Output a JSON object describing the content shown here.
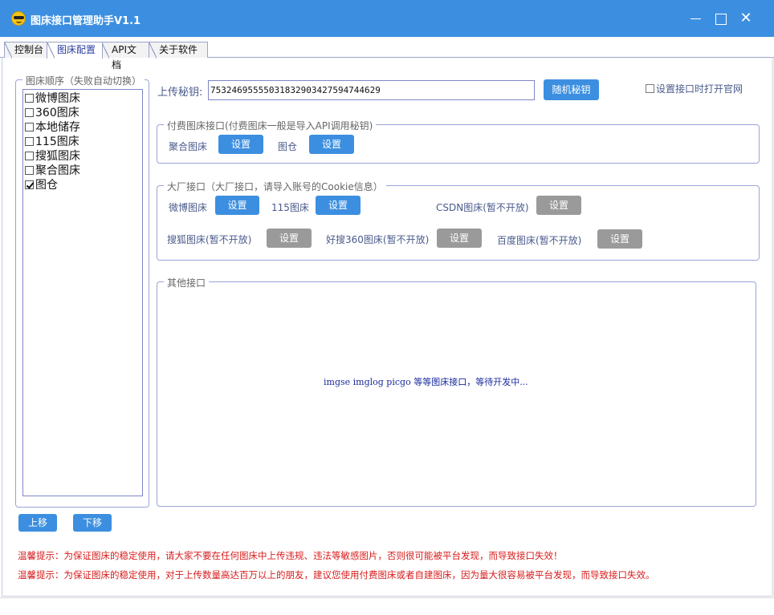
{
  "window": {
    "title": "图床接口管理助手V1.1"
  },
  "tabs": [
    {
      "label": "控制台"
    },
    {
      "label": "图床配置"
    },
    {
      "label": "API文档"
    },
    {
      "label": "关于软件"
    }
  ],
  "order_panel": {
    "legend": "图床顺序（失败自动切换）",
    "items": [
      {
        "label": "微博图床",
        "checked": false
      },
      {
        "label": "360图床",
        "checked": false
      },
      {
        "label": "本地储存",
        "checked": false
      },
      {
        "label": "115图床",
        "checked": false
      },
      {
        "label": "搜狐图床",
        "checked": false
      },
      {
        "label": "聚合图床",
        "checked": false
      },
      {
        "label": "图仓",
        "checked": true
      }
    ],
    "move_up": "上移",
    "move_down": "下移"
  },
  "upload_key": {
    "label": "上传秘钥:",
    "value": "753246955550318329034275947446​29",
    "random_button": "随机秘钥",
    "open_site_label": "设置接口时打开官网"
  },
  "paid_group": {
    "legend": "付费图床接口(付费图床一般是导入API调用秘钥)",
    "items": [
      {
        "label": "聚合图床",
        "button": "设置"
      },
      {
        "label": "图仓",
        "button": "设置"
      }
    ]
  },
  "major_group": {
    "legend": "大厂接口（大厂接口，请导入账号的Cookie信息）",
    "items": [
      {
        "label": "微博图床",
        "button": "设置"
      },
      {
        "label": "115图床",
        "button": "设置"
      },
      {
        "label": "CSDN图床(暂不开放)",
        "button": "设置"
      },
      {
        "label": "搜狐图床(暂不开放)",
        "button": "设置"
      },
      {
        "label": "好搜360图床(暂不开放)",
        "button": "设置"
      },
      {
        "label": "百度图床(暂不开放)",
        "button": "设置"
      }
    ]
  },
  "other_group": {
    "legend": "其他接口",
    "message": "imgse  imglog  picgo 等等图床接口，等待开发中..."
  },
  "tips": [
    "温馨提示：为保证图床的稳定使用，请大家不要在任何图床中上传违规、违法等敏感图片，否则很可能被平台发现，而导致接口失效！",
    "温馨提示：为保证图床的稳定使用，对于上传数量高达百万以上的朋友，建议您使用付费图床或者自建图床，因为量大很容易被平台发现，而导致接口失效。"
  ],
  "colors": {
    "titlebar": "#3c8fe0",
    "button": "#3c8fe0",
    "button_disabled": "#9a9a9a",
    "tip_text": "#d81c1c"
  }
}
